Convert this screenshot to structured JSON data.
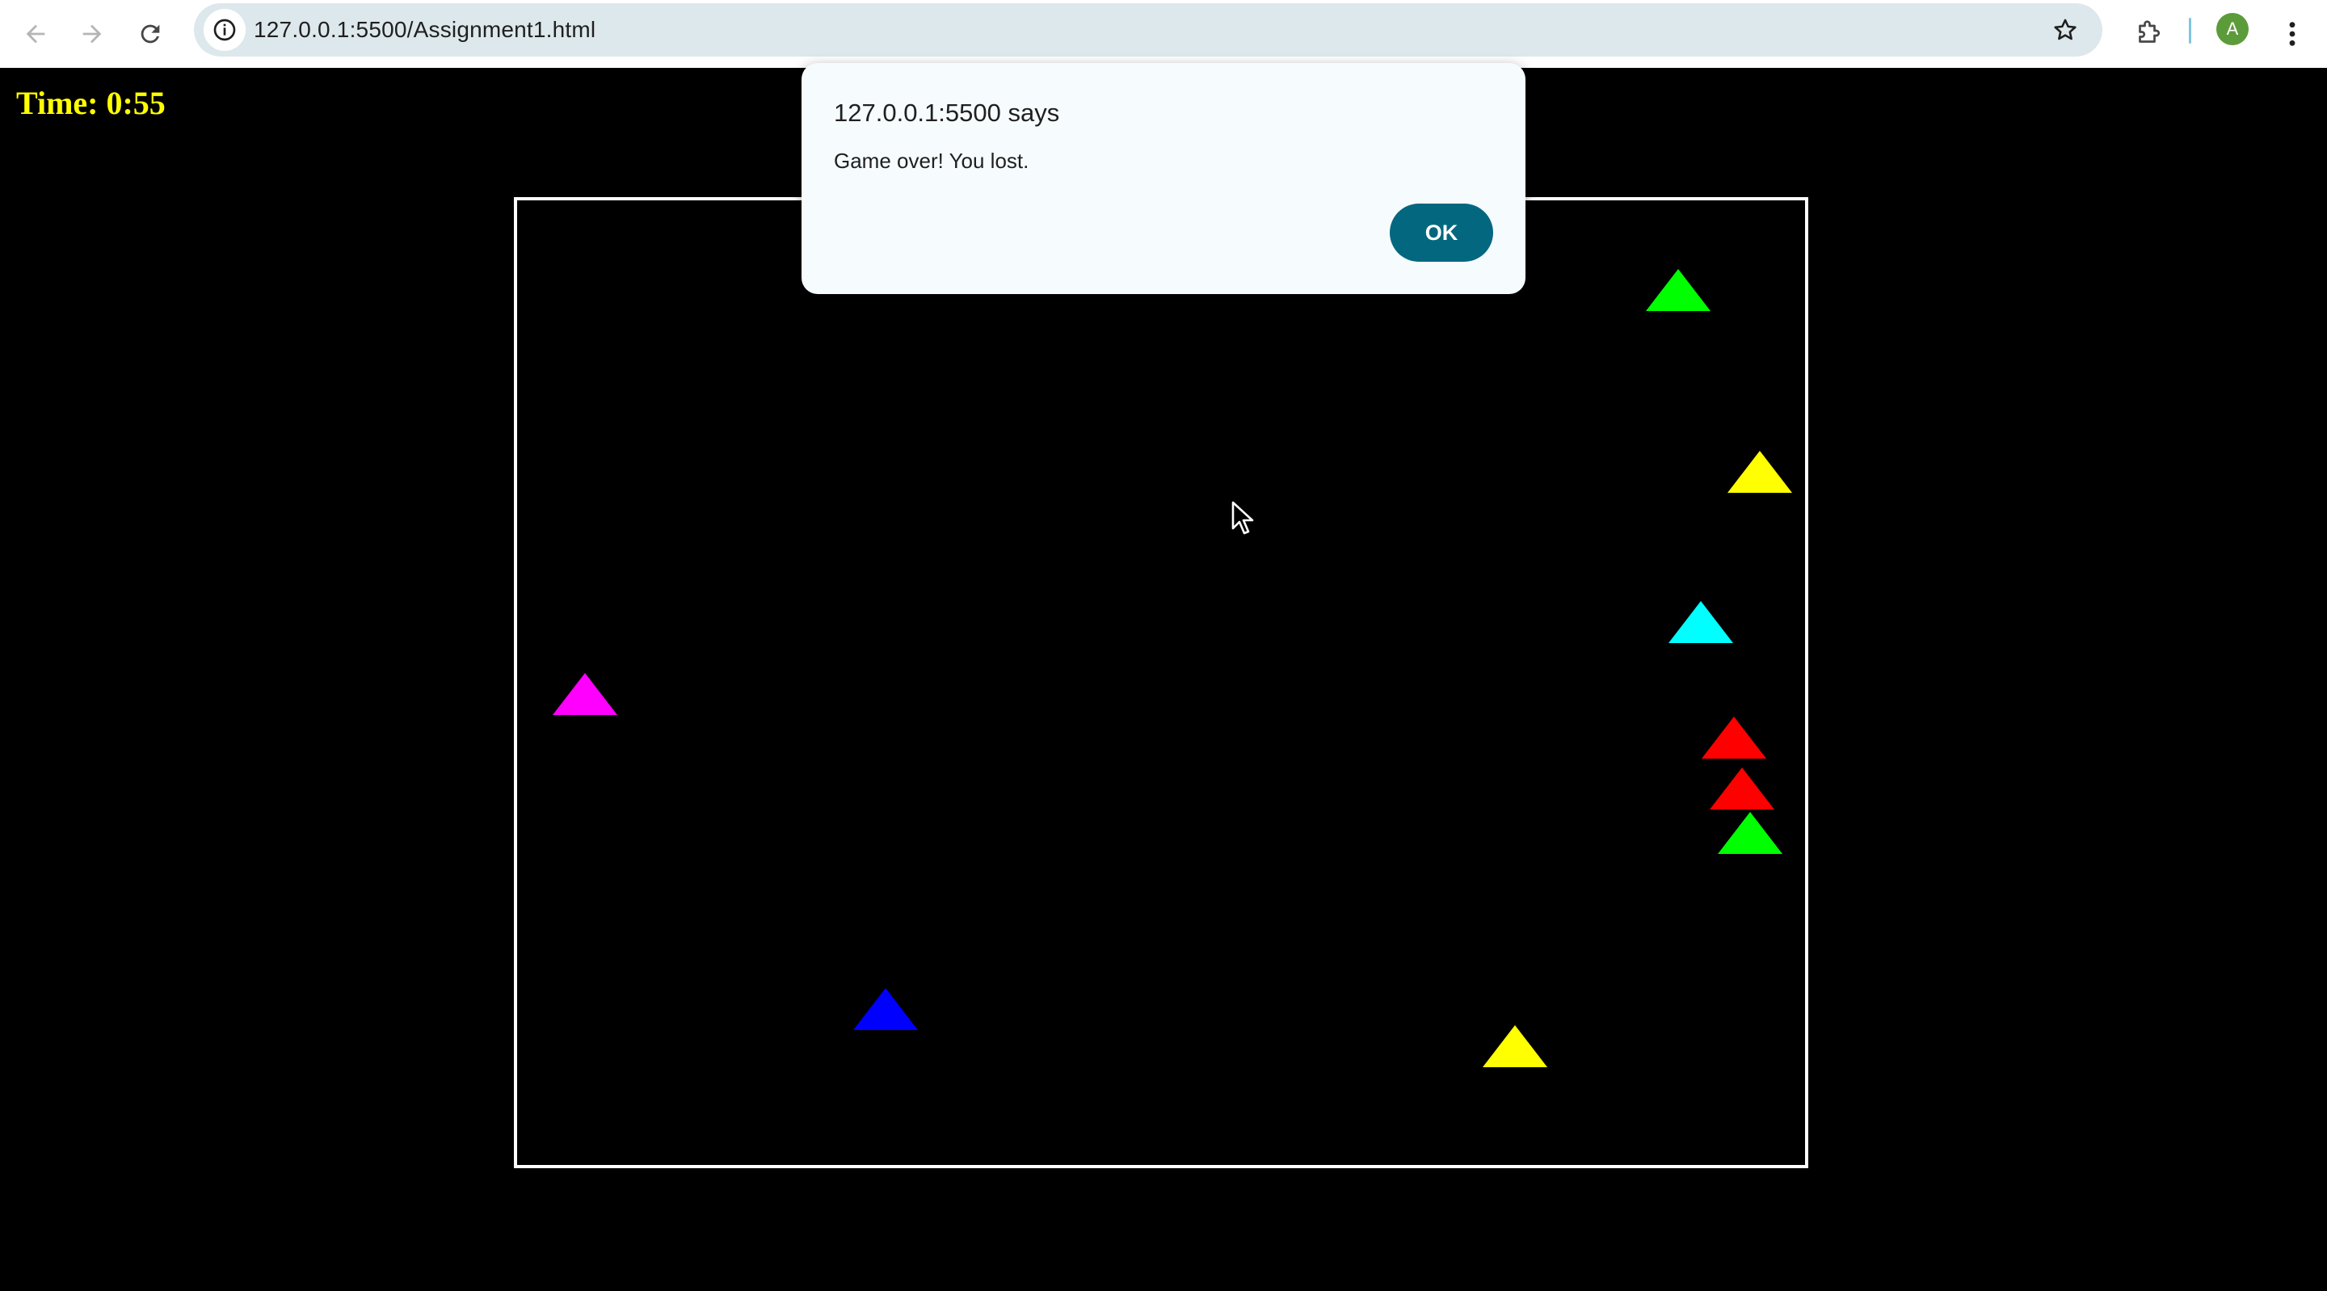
{
  "browser": {
    "url": "127.0.0.1:5500/Assignment1.html",
    "profile_initial": "A",
    "icons": {
      "back": "arrow-left-icon",
      "forward": "arrow-right-icon",
      "reload": "reload-icon",
      "site_info": "info-icon",
      "bookmark": "star-icon",
      "extensions": "puzzle-piece-icon",
      "menu": "kebab-menu-icon"
    }
  },
  "game": {
    "timer_text": "Time: 0:55",
    "timer_color": "#ffff00",
    "border_color": "#ffffff",
    "background": "#000000",
    "triangles": [
      {
        "color": "#00ff00"
      },
      {
        "color": "#ffff00"
      },
      {
        "color": "#00ffff"
      },
      {
        "color": "#ff00ff"
      },
      {
        "color": "#ff0000"
      },
      {
        "color": "#ff0000"
      },
      {
        "color": "#00ff00"
      },
      {
        "color": "#0000ff"
      },
      {
        "color": "#ffff00"
      }
    ]
  },
  "dialog": {
    "title": "127.0.0.1:5500 says",
    "message": "Game over! You lost.",
    "ok_label": "OK",
    "button_color": "#03687f"
  }
}
